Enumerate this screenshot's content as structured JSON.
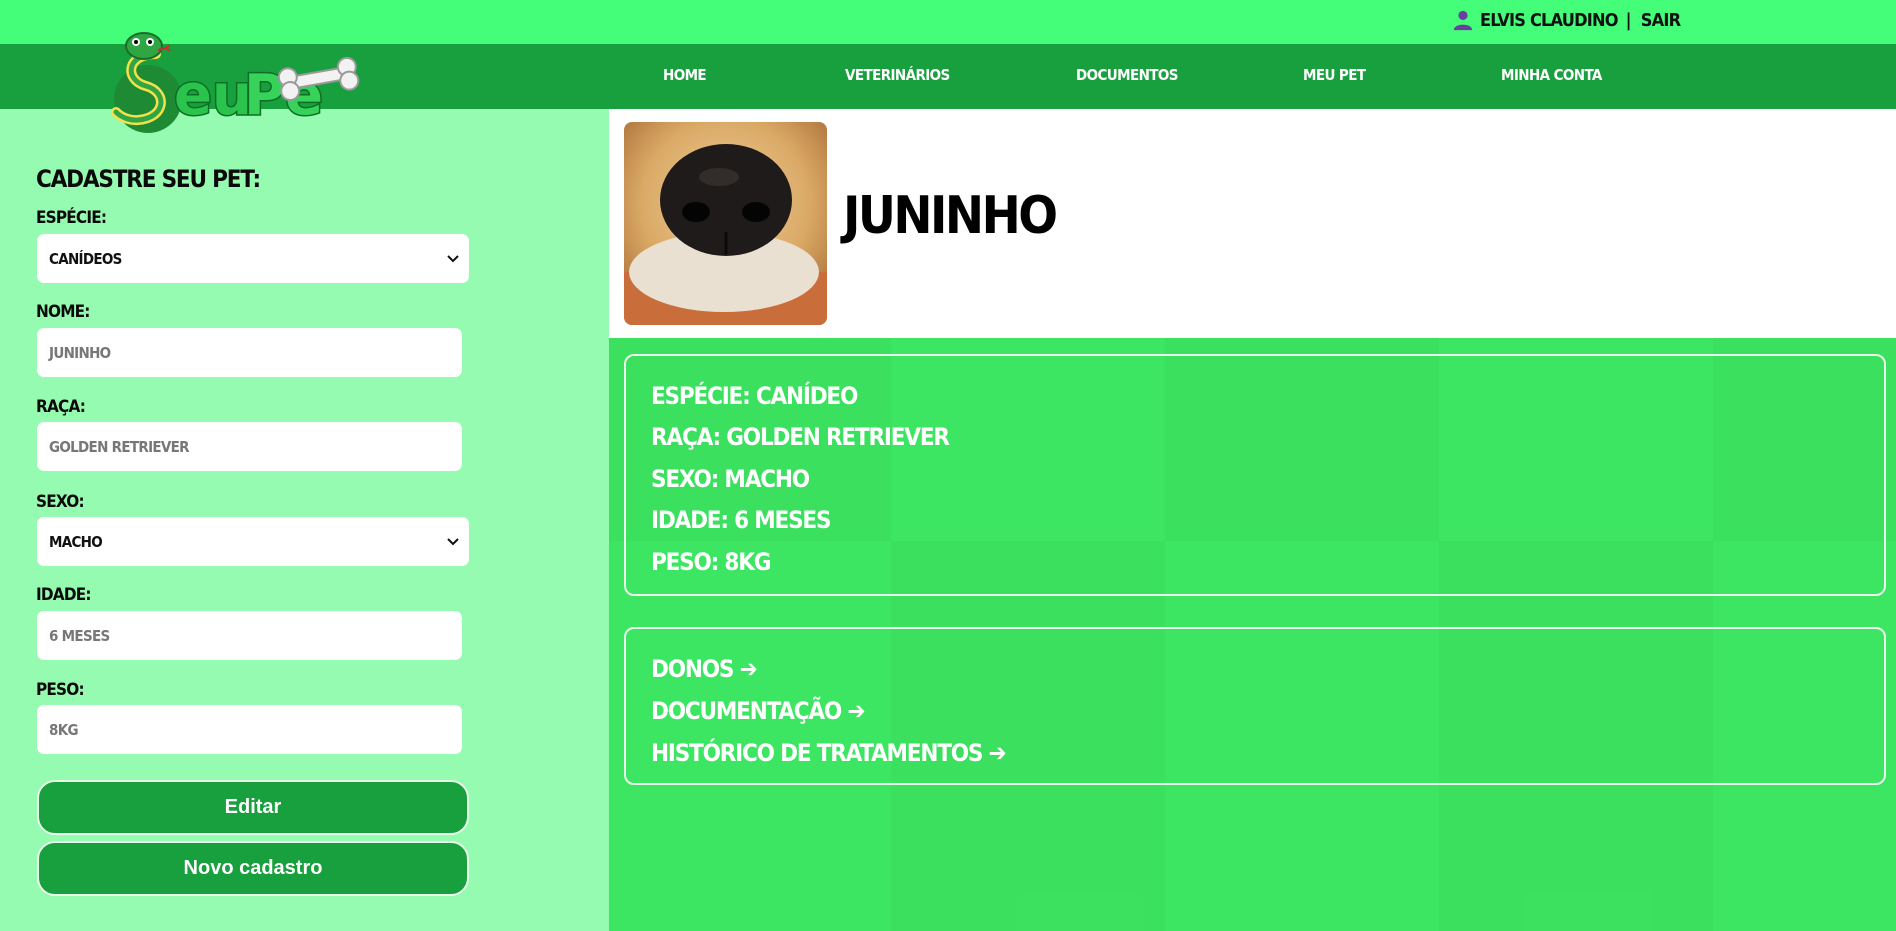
{
  "user": {
    "name": "ELVIS CLAUDINO",
    "separator": "|",
    "logout": "SAIR"
  },
  "logo": {
    "text_part1": "eu",
    "text_part2": "Pe"
  },
  "nav": {
    "home": "HOME",
    "vets": "VETERINÁRIOS",
    "docs": "DOCUMENTOS",
    "mypet": "MEU PET",
    "account": "MINHA CONTA"
  },
  "form": {
    "title": "CADASTRE SEU PET:",
    "species_label": "ESPÉCIE:",
    "species_value": "CANÍDEOS",
    "name_label": "NOME:",
    "name_value": "JUNINHO",
    "breed_label": "RAÇA:",
    "breed_value": "GOLDEN RETRIEVER",
    "sex_label": "SEXO:",
    "sex_value": "MACHO",
    "age_label": "IDADE:",
    "age_value": "6 MESES",
    "weight_label": "PESO:",
    "weight_value": "8KG",
    "edit_button": "Editar",
    "new_button": "Novo cadastro"
  },
  "pet": {
    "name": "JUNINHO",
    "details": {
      "species": "ESPÉCIE: CANÍDEO",
      "breed": "RAÇA: GOLDEN RETRIEVER",
      "sex": "SEXO: MACHO",
      "age": "IDADE: 6 MESES",
      "weight": "PESO: 8KG"
    },
    "links": {
      "owners": "DONOS ➔",
      "documents": "DOCUMENTAÇÃO ➔",
      "history": "HISTÓRICO DE TRATAMENTOS ➔"
    }
  },
  "colors": {
    "top_bar": "#44fd79",
    "nav_bar": "#17a03d",
    "left_panel": "#95fbb0",
    "right_panel": "#3de662",
    "button": "#17a03d"
  }
}
